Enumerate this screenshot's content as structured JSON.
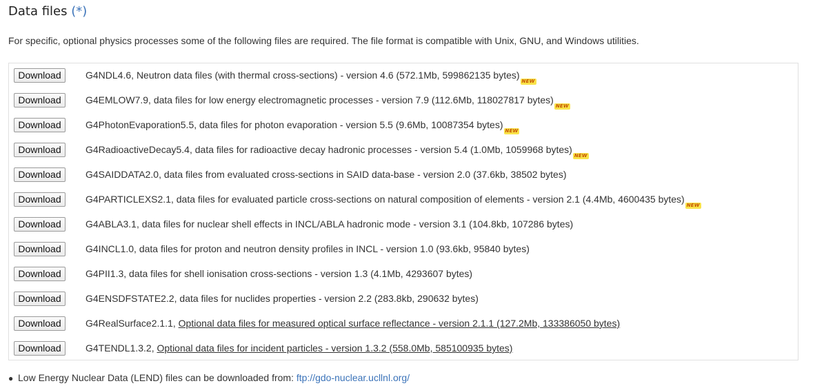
{
  "section": {
    "title": "Data files",
    "title_link": "(*)",
    "intro": "For specific, optional physics processes some of the following files are required. The file format is compatible with Unix, GNU, and Windows utilities."
  },
  "download_label": "Download",
  "new_badge": "NEW",
  "files": [
    {
      "name": "G4NDL4.6, ",
      "text": "Neutron data files (with thermal cross-sections) - version 4.6 (572.1Mb, 599862135 bytes)",
      "new": true,
      "link": false
    },
    {
      "name": "G4EMLOW7.9, ",
      "text": "data files for low energy electromagnetic processes - version 7.9 (112.6Mb, 118027817 bytes)",
      "new": true,
      "link": false
    },
    {
      "name": "G4PhotonEvaporation5.5, ",
      "text": "data files for photon evaporation - version 5.5 (9.6Mb, 10087354 bytes)",
      "new": true,
      "link": false
    },
    {
      "name": "G4RadioactiveDecay5.4, ",
      "text": "data files for radioactive decay hadronic processes - version 5.4 (1.0Mb, 1059968 bytes)",
      "new": true,
      "link": false
    },
    {
      "name": "G4SAIDDATA2.0, ",
      "text": "data files from evaluated cross-sections in SAID data-base - version 2.0 (37.6kb, 38502 bytes)",
      "new": false,
      "link": false
    },
    {
      "name": "G4PARTICLEXS2.1, ",
      "text": "data files for evaluated particle cross-sections on natural composition of elements - version 2.1 (4.4Mb, 4600435 bytes)",
      "new": true,
      "link": false
    },
    {
      "name": "G4ABLA3.1, ",
      "text": "data files for nuclear shell effects in INCL/ABLA hadronic mode - version 3.1 (104.8kb, 107286 bytes)",
      "new": false,
      "link": false
    },
    {
      "name": "G4INCL1.0, ",
      "text": "data files for proton and neutron density profiles in INCL - version 1.0 (93.6kb, 95840 bytes)",
      "new": false,
      "link": false
    },
    {
      "name": "G4PII1.3, ",
      "text": "data files for shell ionisation cross-sections - version 1.3 (4.1Mb, 4293607 bytes)",
      "new": false,
      "link": false
    },
    {
      "name": "G4ENSDFSTATE2.2, ",
      "text": "data files for nuclides properties - version 2.2 (283.8kb, 290632 bytes)",
      "new": false,
      "link": false
    },
    {
      "name": "G4RealSurface2.1.1, ",
      "text": "Optional data files for measured optical surface reflectance - version 2.1.1 (127.2Mb, 133386050 bytes)",
      "new": false,
      "link": true
    },
    {
      "name": "G4TENDL1.3.2, ",
      "text": "Optional data files for incident particles - version 1.3.2 (558.0Mb, 585100935 bytes)",
      "new": false,
      "link": true
    }
  ],
  "note": {
    "text": "Low Energy Nuclear Data (LEND) files can be downloaded from: ",
    "link": "ftp://gdo-nuclear.ucllnl.org/"
  },
  "colors": {
    "accent_link": "#3b73b9",
    "badge_bg": "#f9e34a",
    "badge_text": "#c45200"
  }
}
